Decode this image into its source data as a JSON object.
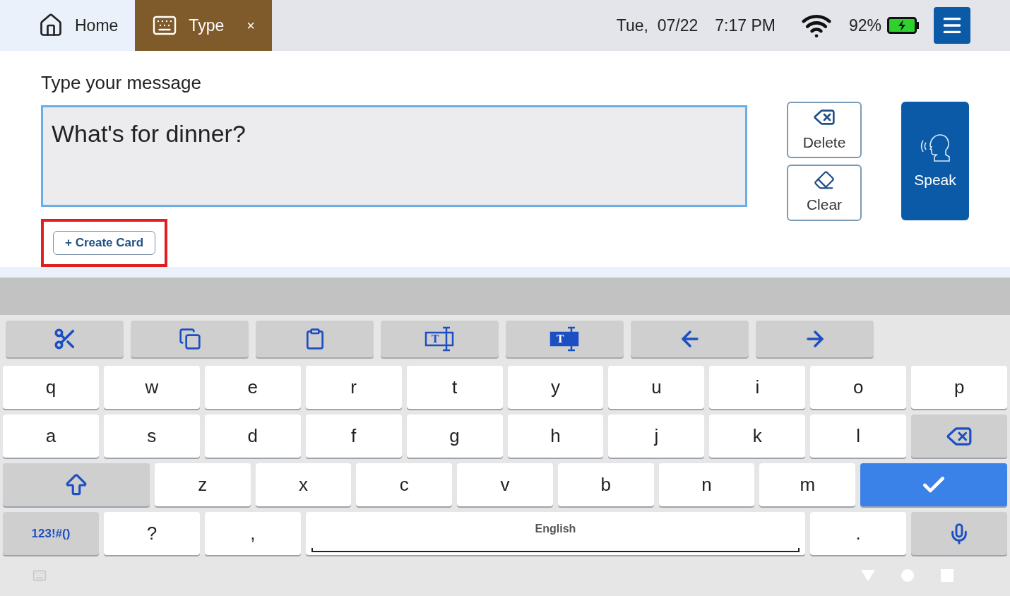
{
  "tabs": [
    {
      "label": "Home",
      "selected": false,
      "kind": "home"
    },
    {
      "label": "Type",
      "selected": true,
      "kind": "type",
      "close": "×"
    }
  ],
  "status": {
    "date": "Tue,  07/22",
    "time": "7:17 PM",
    "battery": "92%"
  },
  "message": {
    "label": "Type your message",
    "value": "What's for dinner?"
  },
  "actions": [
    {
      "label": "Delete",
      "kind": "delete"
    },
    {
      "label": "Clear",
      "kind": "clear"
    }
  ],
  "speak": {
    "label": "Speak"
  },
  "create_card": {
    "label": "+ Create Card",
    "highlighted": true
  },
  "toolbar": [
    {
      "kind": "cut"
    },
    {
      "kind": "copy"
    },
    {
      "kind": "paste"
    },
    {
      "kind": "select",
      "glyph": "T"
    },
    {
      "kind": "select-all",
      "glyph": "T"
    },
    {
      "kind": "left"
    },
    {
      "kind": "right"
    }
  ],
  "keyboard_rows": [
    [
      {
        "kind": "char",
        "label": "q"
      },
      {
        "kind": "char",
        "label": "w"
      },
      {
        "kind": "char",
        "label": "e"
      },
      {
        "kind": "char",
        "label": "r"
      },
      {
        "kind": "char",
        "label": "t"
      },
      {
        "kind": "char",
        "label": "y"
      },
      {
        "kind": "char",
        "label": "u"
      },
      {
        "kind": "char",
        "label": "i"
      },
      {
        "kind": "char",
        "label": "o"
      },
      {
        "kind": "char",
        "label": "p"
      }
    ],
    [
      {
        "kind": "char",
        "label": "a"
      },
      {
        "kind": "char",
        "label": "s"
      },
      {
        "kind": "char",
        "label": "d"
      },
      {
        "kind": "char",
        "label": "f"
      },
      {
        "kind": "char",
        "label": "g"
      },
      {
        "kind": "char",
        "label": "h"
      },
      {
        "kind": "char",
        "label": "j"
      },
      {
        "kind": "char",
        "label": "k"
      },
      {
        "kind": "char",
        "label": "l"
      },
      {
        "kind": "backspace"
      }
    ],
    [
      {
        "kind": "shift"
      },
      {
        "kind": "char",
        "label": "z"
      },
      {
        "kind": "char",
        "label": "x"
      },
      {
        "kind": "char",
        "label": "c"
      },
      {
        "kind": "char",
        "label": "v"
      },
      {
        "kind": "char",
        "label": "b"
      },
      {
        "kind": "char",
        "label": "n"
      },
      {
        "kind": "char",
        "label": "m"
      },
      {
        "kind": "enter"
      }
    ],
    [
      {
        "kind": "symbols",
        "label": "123!#()"
      },
      {
        "kind": "char",
        "label": "?"
      },
      {
        "kind": "char",
        "label": ","
      },
      {
        "kind": "space",
        "label": "English"
      },
      {
        "kind": "char",
        "label": "."
      },
      {
        "kind": "mic"
      }
    ]
  ]
}
